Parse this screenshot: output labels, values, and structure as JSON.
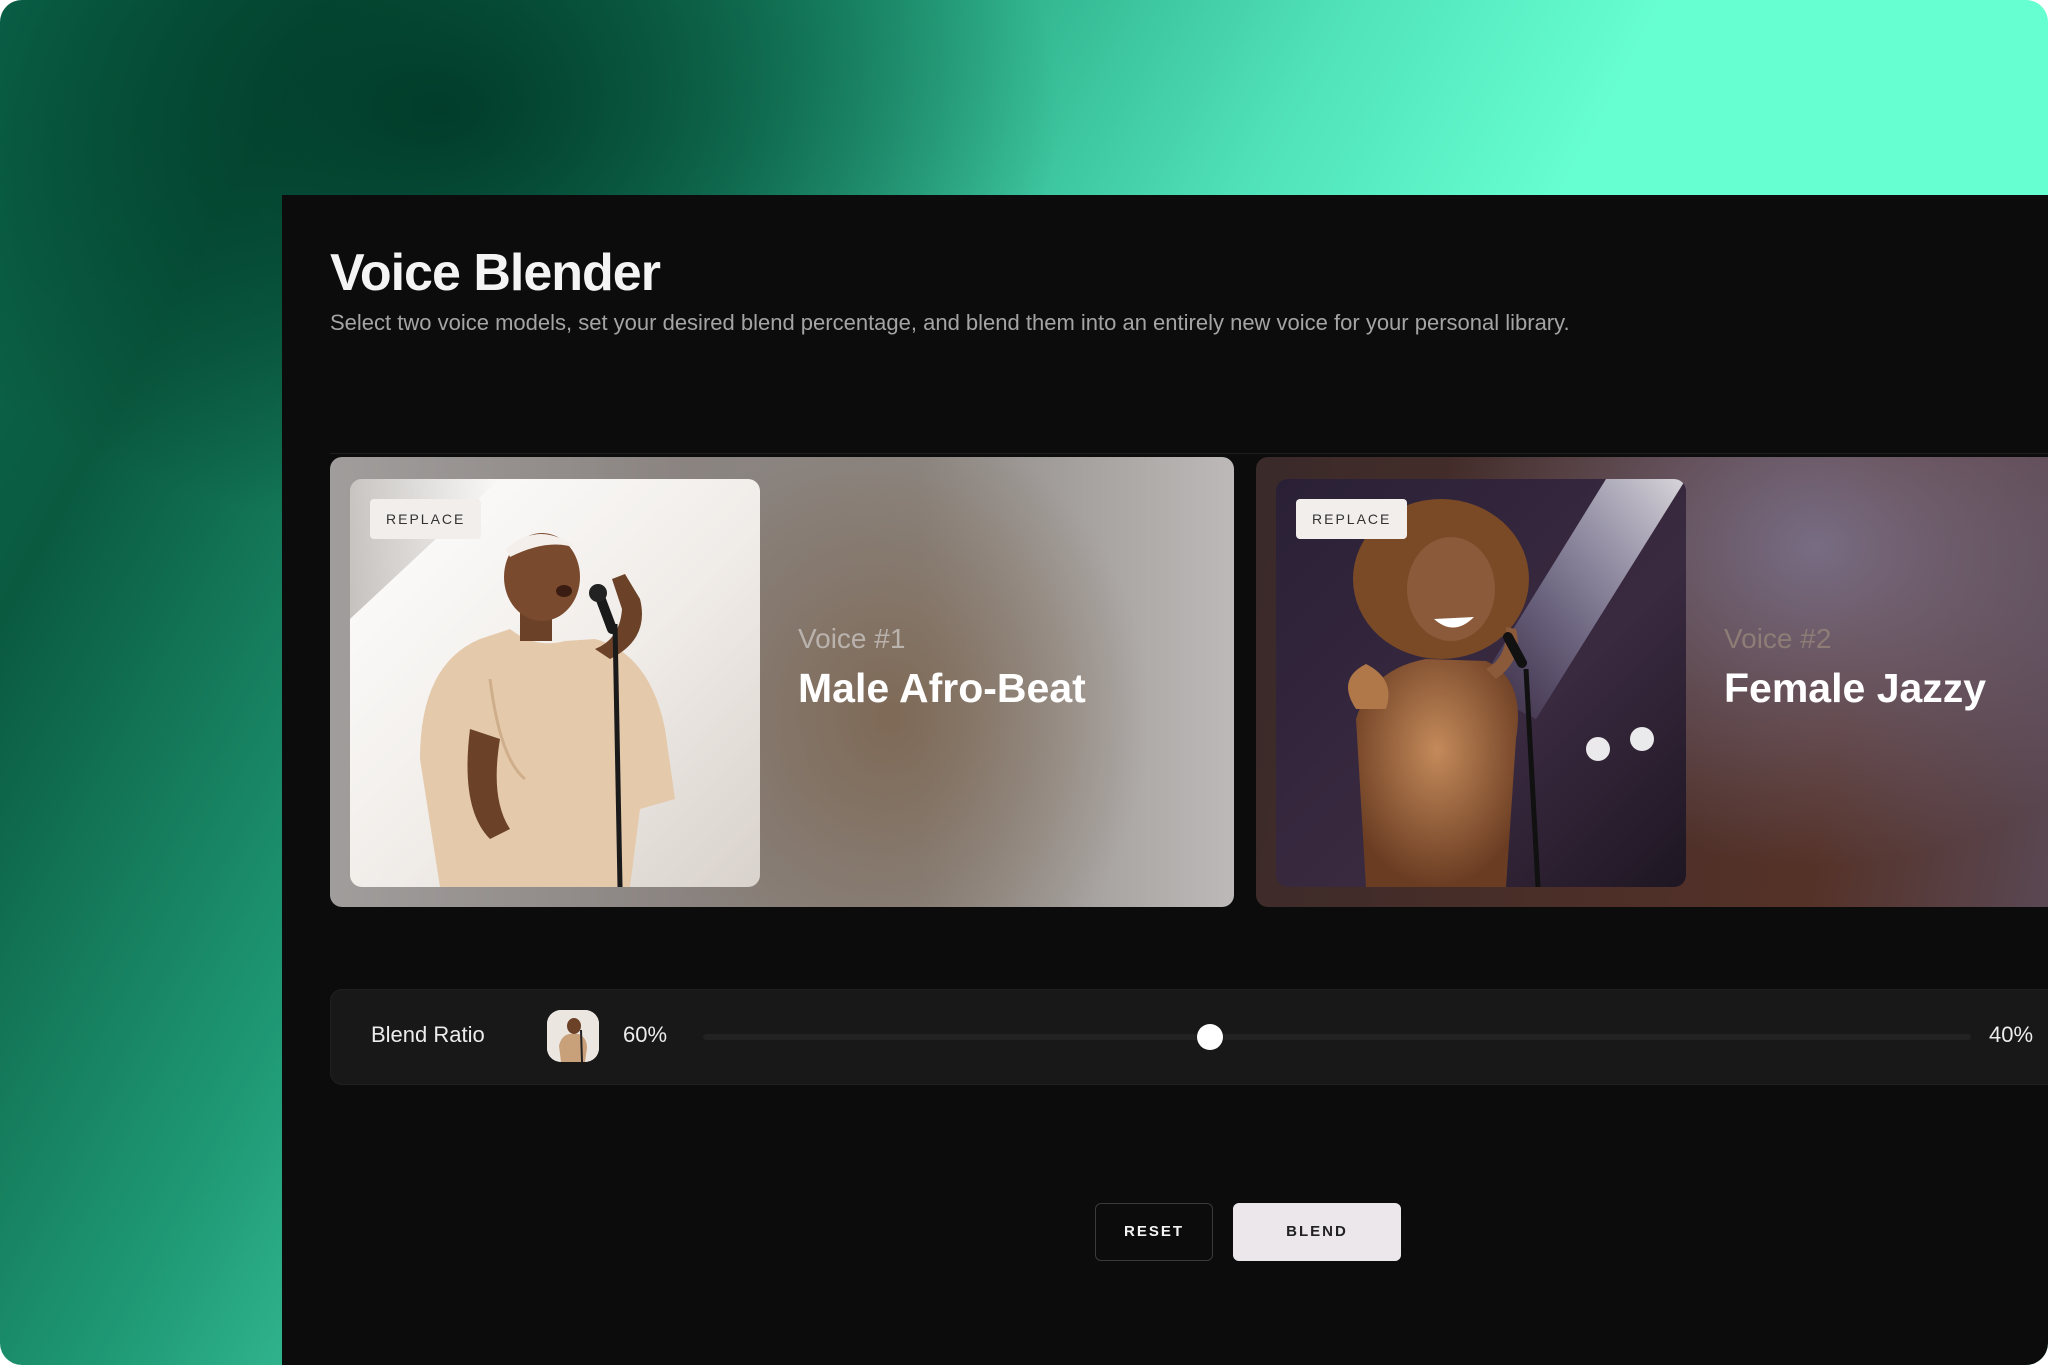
{
  "header": {
    "title": "Voice Blender",
    "subtitle": "Select two voice models, set your desired blend percentage, and blend them into an entirely new voice for your personal library."
  },
  "voices": [
    {
      "replace_label": "REPLACE",
      "index_label": "Voice #1",
      "name": "Male Afro-Beat",
      "image": "male-singer-photo"
    },
    {
      "replace_label": "REPLACE",
      "index_label": "Voice #2",
      "name": "Female Jazzy",
      "image": "female-singer-photo"
    }
  ],
  "blend": {
    "label": "Blend Ratio",
    "left_percent_label": "60%",
    "right_percent_label": "40%",
    "slider_value": 0.4
  },
  "actions": {
    "reset_label": "RESET",
    "blend_label": "BLEND"
  },
  "colors": {
    "accent_mint": "#66ffd1",
    "panel_bg": "#0c0c0c",
    "blend_button_bg": "#ece7ea"
  }
}
